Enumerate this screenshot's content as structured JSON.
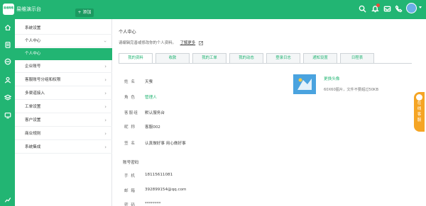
{
  "header": {
    "logo_text": "易维网络",
    "app_title": "易维演示台",
    "add_label": "+ 添加"
  },
  "sidebar": {
    "items": [
      {
        "label": "系统设置",
        "chevron": false
      },
      {
        "label": "个人中心",
        "chevron": true
      },
      {
        "label": "个人中心",
        "chevron": false,
        "active": true
      },
      {
        "label": "企业账号",
        "chevron": true
      },
      {
        "label": "客服账号分组和权限",
        "chevron": true
      },
      {
        "label": "多渠道接入",
        "chevron": true
      },
      {
        "label": "工单设置",
        "chevron": true
      },
      {
        "label": "客户设置",
        "chevron": true
      },
      {
        "label": "商业规则",
        "chevron": true
      },
      {
        "label": "系统集成",
        "chevron": true
      }
    ],
    "chevron_glyph": "›"
  },
  "main": {
    "title": "个人中心",
    "description": "请编辑完善或修改你的个人资料。",
    "learn_more": "了解更多",
    "tabs": [
      "我的资料",
      "收款",
      "我的工单",
      "我的动态",
      "登录日志",
      "通知设置",
      "日程表"
    ],
    "fields": [
      {
        "label": "姓 名",
        "value": "天蚕"
      },
      {
        "label": "角 色",
        "value": "管理人"
      },
      {
        "label": "客服组",
        "value": "默认服务台"
      },
      {
        "label": "昵 称",
        "value": "客服002"
      },
      {
        "label": "签 名",
        "value": "认真做好事 用心做好事"
      }
    ],
    "account_section": "账号密码",
    "account_fields": [
      {
        "label": "手 机",
        "value": "18115611081"
      },
      {
        "label": "邮 箱",
        "value": "392899154@qq.com"
      },
      {
        "label": "密 码",
        "value": "********"
      }
    ],
    "avatar": {
      "change_label": "更换头像",
      "hint": "60X60图片，文件不要超过50KB"
    }
  },
  "float_service": {
    "label_line1": "在",
    "label_line2": "线",
    "label_line3": "客",
    "label_line4": "服"
  },
  "colors": {
    "brand": "#22b573",
    "accent_orange": "#f5a524"
  }
}
